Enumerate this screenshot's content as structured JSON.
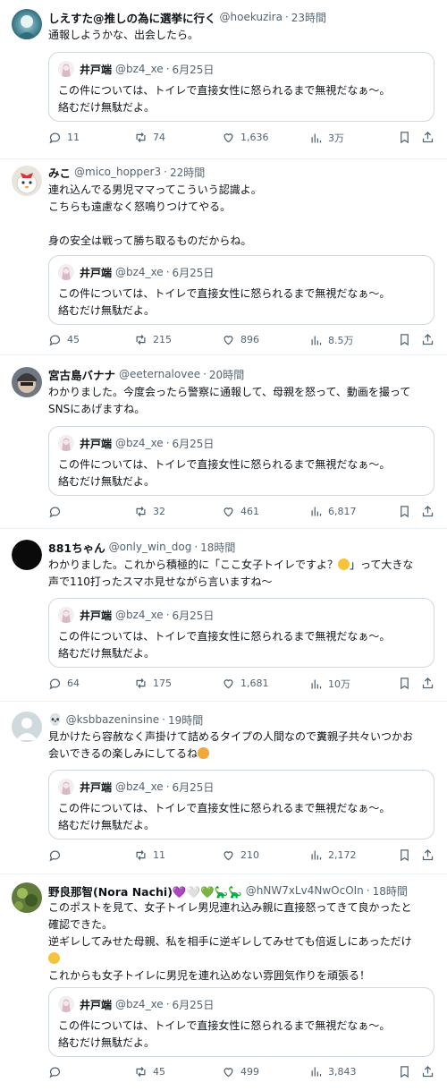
{
  "quoted": {
    "name": "井戸端",
    "handle": "@bz4_xe",
    "dot": "·",
    "time": "6月25日",
    "line1": "この件については、トイレで直接女性に怒られるまで無視だなぁ～。",
    "line2": "絡むだけ無駄だよ。"
  },
  "tweets": [
    {
      "name": "しえすた@推しの為に選挙に行く",
      "handle": "@hoekuzira",
      "dot": "·",
      "time": "23時間",
      "lines": [
        "通報しようかな、出会したら。"
      ],
      "replies": "11",
      "retweets": "74",
      "likes": "1,636",
      "views": "3万"
    },
    {
      "name": "みこ",
      "handle": "@mico_hopper3",
      "dot": "·",
      "time": "22時間",
      "lines": [
        "連れ込んでる男児ママってこういう認識よ。",
        "こちらも遠慮なく怒鳴りつけてやる。",
        "",
        "身の安全は戦って勝ち取るものだからね。"
      ],
      "replies": "45",
      "retweets": "215",
      "likes": "896",
      "views": "8.5万"
    },
    {
      "name": "宮古島バナナ",
      "handle": "@eeternalovee",
      "dot": "·",
      "time": "20時間",
      "lines": [
        "わかりました。今度会ったら警察に通報して、母親を怒って、動画を撮って",
        "SNSにあげますね。"
      ],
      "replies": "",
      "retweets": "32",
      "likes": "461",
      "views": "6,817"
    },
    {
      "name": "881ちゃん",
      "handle": "@only_win_dog",
      "dot": "·",
      "time": "18時間",
      "line1a": "わかりました。これから積極的に「ここ女子トイレですよ？",
      "line1b": "」って大きな",
      "emoji1": "😶",
      "line2": "声で110打ったスマホ見せながら言いますね～",
      "replies": "64",
      "retweets": "175",
      "likes": "1,681",
      "views": "10万"
    },
    {
      "name": "💀",
      "handle": "@ksbbazeninsine",
      "dot": "·",
      "time": "19時間",
      "line1": "見かけたら容赦なく声掛けて詰めるタイプの人間なので糞親子共々いつかお",
      "line2a": "会いできるの楽しみにしてるね",
      "emoji": "😊",
      "replies": "",
      "retweets": "11",
      "likes": "210",
      "views": "2,172"
    },
    {
      "name": "野良那智(Nora Nachi)💜🤍💚🦕🦕",
      "handle": "@hNW7xLv4NwOcOIn",
      "dot": "·",
      "time": "18時間",
      "lines": [
        "このポストを見て、女子トイレ男児連れ込み親に直接怒ってきて良かったと",
        "確認できた。",
        "逆ギレしてみせた母親、私を相手に逆ギレしてみせても倍返しにあっただけ"
      ],
      "emoji": "🤭",
      "line_last": "これからも女子トイレに男児を連れ込めない雰囲気作りを頑張る！",
      "replies": "",
      "retweets": "45",
      "likes": "499",
      "views": "3,843"
    }
  ]
}
